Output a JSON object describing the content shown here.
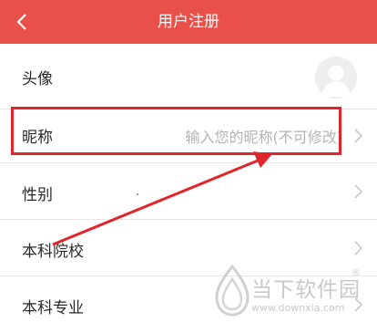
{
  "header": {
    "title": "用户注册"
  },
  "rows": {
    "avatar_label": "头像",
    "nickname_label": "昵称",
    "nickname_placeholder": "输入您的昵称(不可修改)",
    "gender_label": "性别",
    "college_label": "本科院校",
    "major_label": "本科专业"
  },
  "watermark": {
    "brand": "当下软件园",
    "url": "www.downxia.com",
    "reg": "®"
  },
  "colors": {
    "header_bg": "#e9504a",
    "highlight": "#e0262a",
    "arrow": "#e0262a"
  },
  "icons": {
    "back": "chevron-left-icon",
    "chevron": "chevron-right-icon",
    "avatar": "default-avatar-icon"
  }
}
